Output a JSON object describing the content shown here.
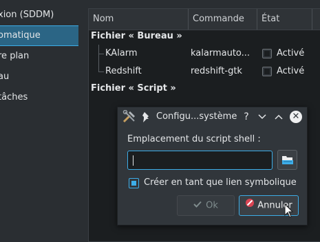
{
  "sidebar": {
    "items": [
      {
        "label": "xion (SDDM)"
      },
      {
        "label": "omatique"
      },
      {
        "label": "re plan"
      },
      {
        "label": "au"
      },
      {
        "label": " tâches"
      }
    ]
  },
  "table": {
    "columns": [
      "Nom",
      "Commande",
      "État"
    ],
    "groups": [
      {
        "label": "Fichier « Bureau »"
      },
      {
        "label": "Fichier « Script »"
      }
    ],
    "rows": [
      {
        "name": "KAlarm",
        "command": "kalarmauto...",
        "state": "Activé"
      },
      {
        "name": "Redshift",
        "command": "redshift-gtk",
        "state": "Activé"
      }
    ]
  },
  "dialog": {
    "title": "Configu...système",
    "help_label": "?",
    "field_label": "Emplacement du script shell :",
    "input_value": "",
    "checkbox_label": "Créer en tant que lien symbolique",
    "ok_label": "Ok",
    "cancel_label": "Annuler",
    "close_label": "✕"
  },
  "colors": {
    "accent": "#3daee9",
    "selection": "#2b6585",
    "danger": "#da4453"
  },
  "icons": [
    "tools-icon",
    "pin-icon",
    "chevron-down-icon",
    "chevron-up-icon",
    "close-icon",
    "folder-open-icon",
    "checkmark-icon",
    "cancel-icon",
    "mouse-cursor-icon"
  ]
}
